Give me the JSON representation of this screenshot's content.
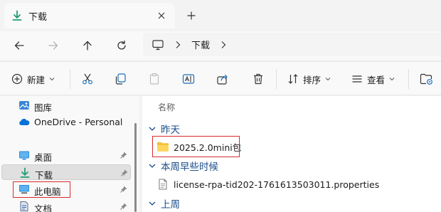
{
  "window": {
    "tab_title": "下载"
  },
  "address": {
    "segment": "下载"
  },
  "toolbar": {
    "new_label": "新建",
    "sort_label": "排序",
    "view_label": "查看"
  },
  "sidebar": {
    "items": [
      {
        "label": "图库",
        "icon": "gallery-icon",
        "pinned": false
      },
      {
        "label": "OneDrive - Personal",
        "icon": "onedrive-icon",
        "pinned": false
      },
      {
        "label": "桌面",
        "icon": "desktop-icon",
        "pinned": true
      },
      {
        "label": "下载",
        "icon": "download-icon",
        "pinned": true,
        "selected": true
      },
      {
        "label": "此电脑",
        "icon": "this-pc-icon",
        "pinned": true
      },
      {
        "label": "文档",
        "icon": "documents-icon",
        "pinned": true
      }
    ]
  },
  "content": {
    "column_name": "名称",
    "groups": [
      {
        "label": "昨天",
        "files": [
          {
            "name": "2025.2.0mini包",
            "type": "folder"
          }
        ]
      },
      {
        "label": "本周早些时候",
        "files": [
          {
            "name": "license-rpa-tid202-1761613503011.properties",
            "type": "file"
          }
        ]
      },
      {
        "label": "上周",
        "files": []
      }
    ]
  },
  "colors": {
    "accent": "#0067c0",
    "group_text": "#1a4e8a",
    "highlight_box": "#d92b2b",
    "folder": "#f3c13a"
  }
}
